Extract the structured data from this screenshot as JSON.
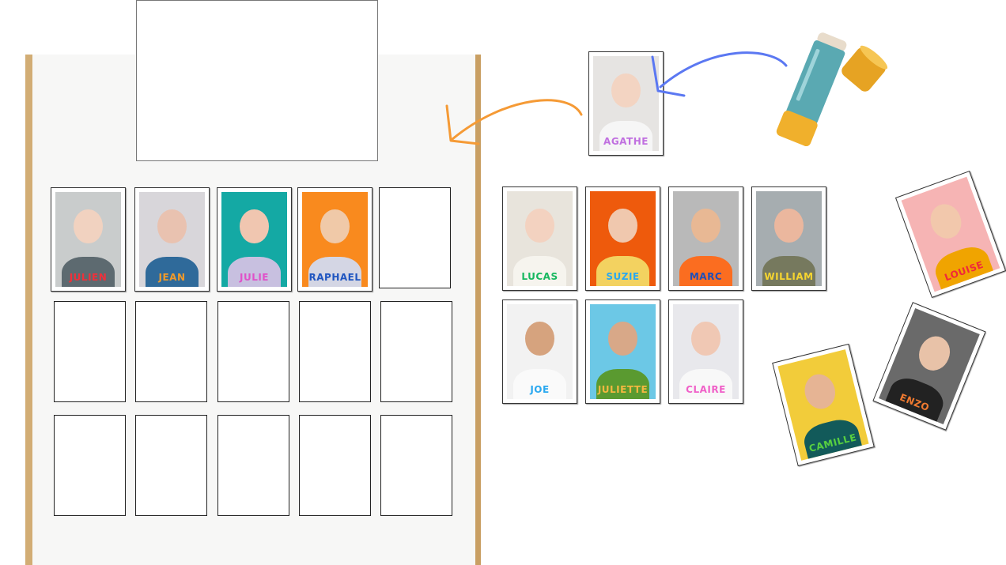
{
  "board_cards": [
    {
      "name": "JULIEN",
      "color": "#f0303a",
      "bg": "#c9cccc",
      "skin": "#f1d2c0",
      "shirt": "#5d6a70"
    },
    {
      "name": "JEAN",
      "color": "#f09a2a",
      "bg": "#d8d6da",
      "skin": "#e9c2b0",
      "shirt": "#2f6a9a"
    },
    {
      "name": "JULIE",
      "color": "#e050c8",
      "bg": "#14a9a4",
      "skin": "#f0c6b0",
      "shirt": "#c8c0e0"
    },
    {
      "name": "RAPHAEL",
      "color": "#1f55c0",
      "bg": "#f98a1e",
      "skin": "#f0c9a8",
      "shirt": "#d4d6e4"
    }
  ],
  "board_empty_slots": 11,
  "featured_card": {
    "name": "AGATHE",
    "color": "#c070e0",
    "bg": "#e6e4e2",
    "skin": "#f3d4c2",
    "shirt": "#f6f6f6"
  },
  "pool_cards": [
    {
      "name": "LUCAS",
      "color": "#18b860",
      "bg": "#e8e4dc",
      "skin": "#f3d2c0",
      "shirt": "#f6f4ee"
    },
    {
      "name": "SUZIE",
      "color": "#2aa8f0",
      "bg": "#ee5a0c",
      "skin": "#f0c8ae",
      "shirt": "#f3d260"
    },
    {
      "name": "MARC",
      "color": "#1f4fb8",
      "bg": "#b9b9b9",
      "skin": "#e8b894",
      "shirt": "#fb6d20"
    },
    {
      "name": "WILLIAM",
      "color": "#f6d530",
      "bg": "#a6adb0",
      "skin": "#ebb79e",
      "shirt": "#76795e"
    },
    {
      "name": "JOE",
      "color": "#2aa8f0",
      "bg": "#f2f2f2",
      "skin": "#d6a37e",
      "shirt": "#fafafa"
    },
    {
      "name": "JULIETTE",
      "color": "#f4b840",
      "bg": "#6cc8e6",
      "skin": "#d8a888",
      "shirt": "#5a9a30"
    },
    {
      "name": "CLAIRE",
      "color": "#f060c8",
      "bg": "#e8e8ec",
      "skin": "#f0c8b4",
      "shirt": "#f8f8f8"
    }
  ],
  "scattered_cards": [
    {
      "name": "LOUISE",
      "color": "#f0283a",
      "bg": "#f6b4b4",
      "skin": "#f2c8ac",
      "shirt": "#f0a400"
    },
    {
      "name": "ENZO",
      "color": "#f07a30",
      "bg": "#6a6a6a",
      "skin": "#e8c2a8",
      "shirt": "#222"
    },
    {
      "name": "CAMILLE",
      "color": "#58d040",
      "bg": "#f2cc3a",
      "skin": "#e6b494",
      "shirt": "#125a5a"
    }
  ],
  "colors": {
    "arrow_blue": "#5b78f2",
    "arrow_orange": "#f59a35",
    "glue_body": "#5aa9b2",
    "glue_cap": "#f0b02c"
  }
}
